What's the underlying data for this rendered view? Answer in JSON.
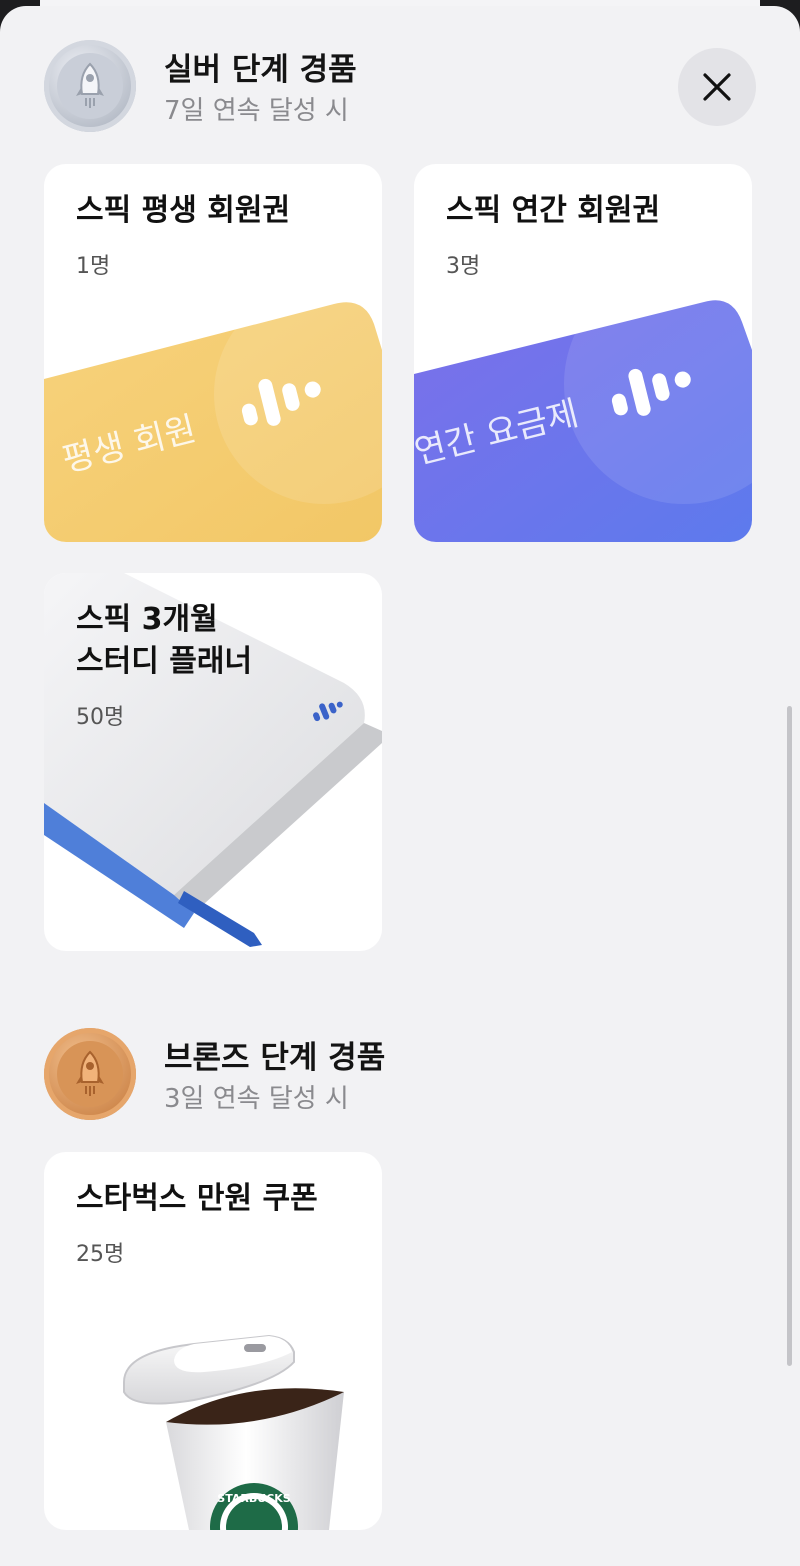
{
  "sections": [
    {
      "title": "실버 단계 경품",
      "subtitle": "7일 연속 달성 시",
      "medal": "silver-rocket-medal-icon",
      "prizes": [
        {
          "name": "스픽 평생 회원권",
          "count": "1명",
          "card_text": "평생 회원"
        },
        {
          "name": "스픽 연간 회원권",
          "count": "3명",
          "card_text": "연간 요금제"
        },
        {
          "name_line1": "스픽 3개월",
          "name_line2": "스터디 플래너",
          "count": "50명"
        }
      ]
    },
    {
      "title": "브론즈 단계 경품",
      "subtitle": "3일 연속 달성 시",
      "medal": "bronze-rocket-medal-icon",
      "prizes": [
        {
          "name": "스타벅스 만원 쿠폰",
          "count": "25명",
          "cup_text": "STARBUCKS"
        }
      ]
    }
  ],
  "close_icon": "close-icon",
  "colors": {
    "gold_card": "#f5cf73",
    "blue_card": "#6c7bec",
    "planner_ribbon": "#4f7fd9",
    "sheet_bg": "#f2f2f4"
  }
}
